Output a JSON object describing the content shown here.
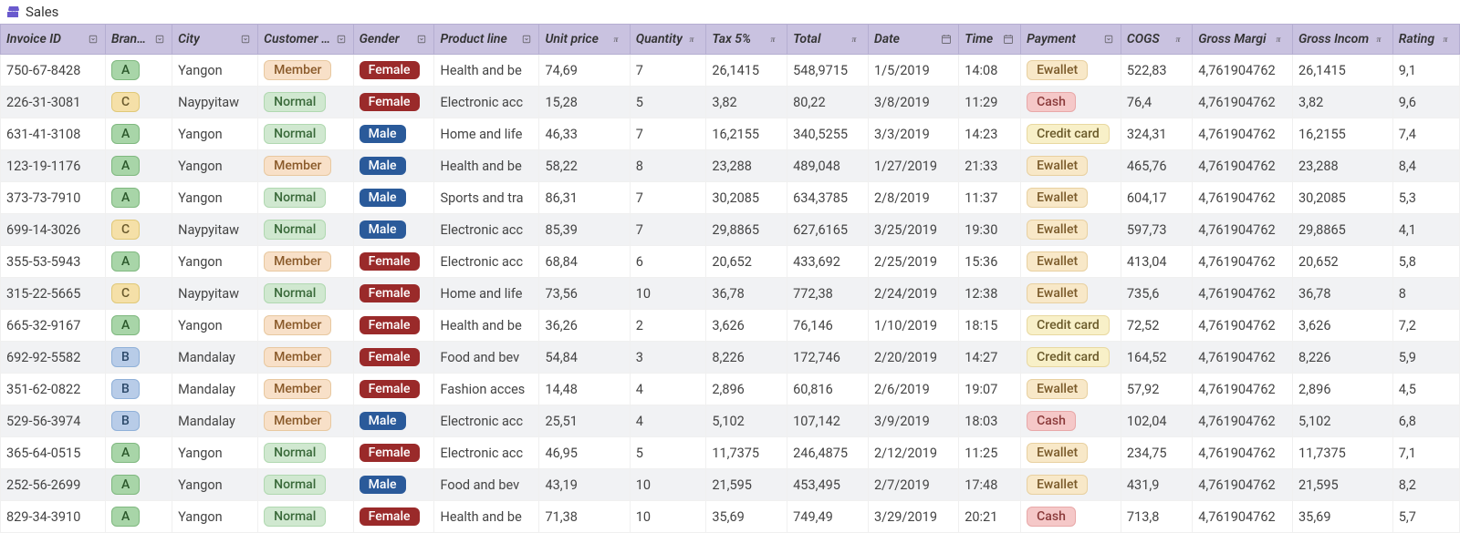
{
  "title": "Sales",
  "columns": [
    {
      "key": "invoice",
      "label": "Invoice ID",
      "icon": "dropdown",
      "cls": "col-invoice"
    },
    {
      "key": "branch",
      "label": "Branch",
      "icon": "dropdown",
      "cls": "col-branch"
    },
    {
      "key": "city",
      "label": "City",
      "icon": "dropdown",
      "cls": "col-city"
    },
    {
      "key": "customer",
      "label": "Customer ty",
      "icon": "dropdown",
      "cls": "col-cust"
    },
    {
      "key": "gender",
      "label": "Gender",
      "icon": "dropdown",
      "cls": "col-gender"
    },
    {
      "key": "product",
      "label": "Product line",
      "icon": "dropdown",
      "cls": "col-product"
    },
    {
      "key": "unit",
      "label": "Unit price",
      "icon": "pi",
      "cls": "col-unit"
    },
    {
      "key": "qty",
      "label": "Quantity",
      "icon": "pi",
      "cls": "col-qty"
    },
    {
      "key": "tax",
      "label": "Tax 5%",
      "icon": "pi",
      "cls": "col-tax"
    },
    {
      "key": "total",
      "label": "Total",
      "icon": "pi",
      "cls": "col-total"
    },
    {
      "key": "date",
      "label": "Date",
      "icon": "calendar",
      "cls": "col-date"
    },
    {
      "key": "time",
      "label": "Time",
      "icon": "calendar",
      "cls": "col-time"
    },
    {
      "key": "payment",
      "label": "Payment",
      "icon": "dropdown",
      "cls": "col-payment"
    },
    {
      "key": "cogs",
      "label": "COGS",
      "icon": "pi",
      "cls": "col-cogs"
    },
    {
      "key": "gm",
      "label": "Gross Margi",
      "icon": "pi",
      "cls": "col-gm"
    },
    {
      "key": "gi",
      "label": "Gross Incom",
      "icon": "pi",
      "cls": "col-gi"
    },
    {
      "key": "rating",
      "label": "Rating",
      "icon": "pi",
      "cls": "col-rating"
    }
  ],
  "rows": [
    {
      "invoice": "750-67-8428",
      "branch": "A",
      "city": "Yangon",
      "customer": "Member",
      "gender": "Female",
      "product": "Health and be",
      "unit": "74,69",
      "qty": "7",
      "tax": "26,1415",
      "total": "548,9715",
      "date": "1/5/2019",
      "time": "14:08",
      "payment": "Ewallet",
      "cogs": "522,83",
      "gm": "4,761904762",
      "gi": "26,1415",
      "rating": "9,1"
    },
    {
      "invoice": "226-31-3081",
      "branch": "C",
      "city": "Naypyitaw",
      "customer": "Normal",
      "gender": "Female",
      "product": "Electronic acc",
      "unit": "15,28",
      "qty": "5",
      "tax": "3,82",
      "total": "80,22",
      "date": "3/8/2019",
      "time": "11:29",
      "payment": "Cash",
      "cogs": "76,4",
      "gm": "4,761904762",
      "gi": "3,82",
      "rating": "9,6"
    },
    {
      "invoice": "631-41-3108",
      "branch": "A",
      "city": "Yangon",
      "customer": "Normal",
      "gender": "Male",
      "product": "Home and life",
      "unit": "46,33",
      "qty": "7",
      "tax": "16,2155",
      "total": "340,5255",
      "date": "3/3/2019",
      "time": "14:23",
      "payment": "Credit card",
      "cogs": "324,31",
      "gm": "4,761904762",
      "gi": "16,2155",
      "rating": "7,4"
    },
    {
      "invoice": "123-19-1176",
      "branch": "A",
      "city": "Yangon",
      "customer": "Member",
      "gender": "Male",
      "product": "Health and be",
      "unit": "58,22",
      "qty": "8",
      "tax": "23,288",
      "total": "489,048",
      "date": "1/27/2019",
      "time": "21:33",
      "payment": "Ewallet",
      "cogs": "465,76",
      "gm": "4,761904762",
      "gi": "23,288",
      "rating": "8,4"
    },
    {
      "invoice": "373-73-7910",
      "branch": "A",
      "city": "Yangon",
      "customer": "Normal",
      "gender": "Male",
      "product": "Sports and tra",
      "unit": "86,31",
      "qty": "7",
      "tax": "30,2085",
      "total": "634,3785",
      "date": "2/8/2019",
      "time": "11:37",
      "payment": "Ewallet",
      "cogs": "604,17",
      "gm": "4,761904762",
      "gi": "30,2085",
      "rating": "5,3"
    },
    {
      "invoice": "699-14-3026",
      "branch": "C",
      "city": "Naypyitaw",
      "customer": "Normal",
      "gender": "Male",
      "product": "Electronic acc",
      "unit": "85,39",
      "qty": "7",
      "tax": "29,8865",
      "total": "627,6165",
      "date": "3/25/2019",
      "time": "19:30",
      "payment": "Ewallet",
      "cogs": "597,73",
      "gm": "4,761904762",
      "gi": "29,8865",
      "rating": "4,1"
    },
    {
      "invoice": "355-53-5943",
      "branch": "A",
      "city": "Yangon",
      "customer": "Member",
      "gender": "Female",
      "product": "Electronic acc",
      "unit": "68,84",
      "qty": "6",
      "tax": "20,652",
      "total": "433,692",
      "date": "2/25/2019",
      "time": "15:36",
      "payment": "Ewallet",
      "cogs": "413,04",
      "gm": "4,761904762",
      "gi": "20,652",
      "rating": "5,8"
    },
    {
      "invoice": "315-22-5665",
      "branch": "C",
      "city": "Naypyitaw",
      "customer": "Normal",
      "gender": "Female",
      "product": "Home and life",
      "unit": "73,56",
      "qty": "10",
      "tax": "36,78",
      "total": "772,38",
      "date": "2/24/2019",
      "time": "12:38",
      "payment": "Ewallet",
      "cogs": "735,6",
      "gm": "4,761904762",
      "gi": "36,78",
      "rating": "8"
    },
    {
      "invoice": "665-32-9167",
      "branch": "A",
      "city": "Yangon",
      "customer": "Member",
      "gender": "Female",
      "product": "Health and be",
      "unit": "36,26",
      "qty": "2",
      "tax": "3,626",
      "total": "76,146",
      "date": "1/10/2019",
      "time": "18:15",
      "payment": "Credit card",
      "cogs": "72,52",
      "gm": "4,761904762",
      "gi": "3,626",
      "rating": "7,2"
    },
    {
      "invoice": "692-92-5582",
      "branch": "B",
      "city": "Mandalay",
      "customer": "Member",
      "gender": "Female",
      "product": "Food and bev",
      "unit": "54,84",
      "qty": "3",
      "tax": "8,226",
      "total": "172,746",
      "date": "2/20/2019",
      "time": "14:27",
      "payment": "Credit card",
      "cogs": "164,52",
      "gm": "4,761904762",
      "gi": "8,226",
      "rating": "5,9"
    },
    {
      "invoice": "351-62-0822",
      "branch": "B",
      "city": "Mandalay",
      "customer": "Member",
      "gender": "Female",
      "product": "Fashion acces",
      "unit": "14,48",
      "qty": "4",
      "tax": "2,896",
      "total": "60,816",
      "date": "2/6/2019",
      "time": "19:07",
      "payment": "Ewallet",
      "cogs": "57,92",
      "gm": "4,761904762",
      "gi": "2,896",
      "rating": "4,5"
    },
    {
      "invoice": "529-56-3974",
      "branch": "B",
      "city": "Mandalay",
      "customer": "Member",
      "gender": "Male",
      "product": "Electronic acc",
      "unit": "25,51",
      "qty": "4",
      "tax": "5,102",
      "total": "107,142",
      "date": "3/9/2019",
      "time": "18:03",
      "payment": "Cash",
      "cogs": "102,04",
      "gm": "4,761904762",
      "gi": "5,102",
      "rating": "6,8"
    },
    {
      "invoice": "365-64-0515",
      "branch": "A",
      "city": "Yangon",
      "customer": "Normal",
      "gender": "Female",
      "product": "Electronic acc",
      "unit": "46,95",
      "qty": "5",
      "tax": "11,7375",
      "total": "246,4875",
      "date": "2/12/2019",
      "time": "11:25",
      "payment": "Ewallet",
      "cogs": "234,75",
      "gm": "4,761904762",
      "gi": "11,7375",
      "rating": "7,1"
    },
    {
      "invoice": "252-56-2699",
      "branch": "A",
      "city": "Yangon",
      "customer": "Normal",
      "gender": "Male",
      "product": "Food and bev",
      "unit": "43,19",
      "qty": "10",
      "tax": "21,595",
      "total": "453,495",
      "date": "2/7/2019",
      "time": "17:48",
      "payment": "Ewallet",
      "cogs": "431,9",
      "gm": "4,761904762",
      "gi": "21,595",
      "rating": "8,2"
    },
    {
      "invoice": "829-34-3910",
      "branch": "A",
      "city": "Yangon",
      "customer": "Normal",
      "gender": "Female",
      "product": "Health and be",
      "unit": "71,38",
      "qty": "10",
      "tax": "35,69",
      "total": "749,49",
      "date": "3/29/2019",
      "time": "20:21",
      "payment": "Cash",
      "cogs": "713,8",
      "gm": "4,761904762",
      "gi": "35,69",
      "rating": "5,7"
    }
  ]
}
